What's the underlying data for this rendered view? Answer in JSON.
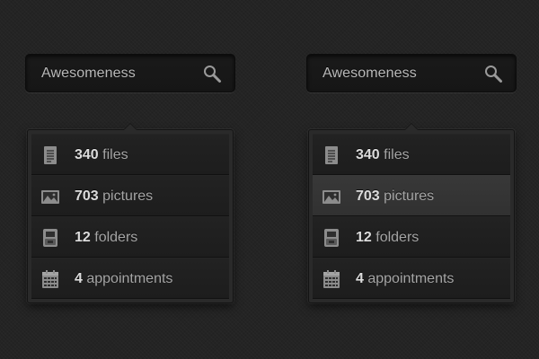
{
  "widgets": [
    {
      "search": {
        "value": "Awesomeness",
        "icon": "magnifier-icon"
      },
      "items": [
        {
          "count": "340",
          "label": "files",
          "icon": "document-icon"
        },
        {
          "count": "703",
          "label": "pictures",
          "icon": "picture-icon"
        },
        {
          "count": "12",
          "label": "folders",
          "icon": "folder-icon"
        },
        {
          "count": "4",
          "label": "appointments",
          "icon": "calendar-icon"
        }
      ]
    },
    {
      "search": {
        "value": "Awesomeness",
        "icon": "magnifier-icon"
      },
      "items": [
        {
          "count": "340",
          "label": "files",
          "icon": "document-icon"
        },
        {
          "count": "703",
          "label": "pictures",
          "icon": "picture-icon",
          "state": "hovered"
        },
        {
          "count": "12",
          "label": "folders",
          "icon": "folder-icon"
        },
        {
          "count": "4",
          "label": "appointments",
          "icon": "calendar-icon"
        }
      ]
    }
  ],
  "colors": {
    "background": "#242424",
    "row": "#1f1f1f",
    "row_hovered": "#353535",
    "count_text": "#dcdcdc",
    "label_text": "#a5a5a5"
  }
}
